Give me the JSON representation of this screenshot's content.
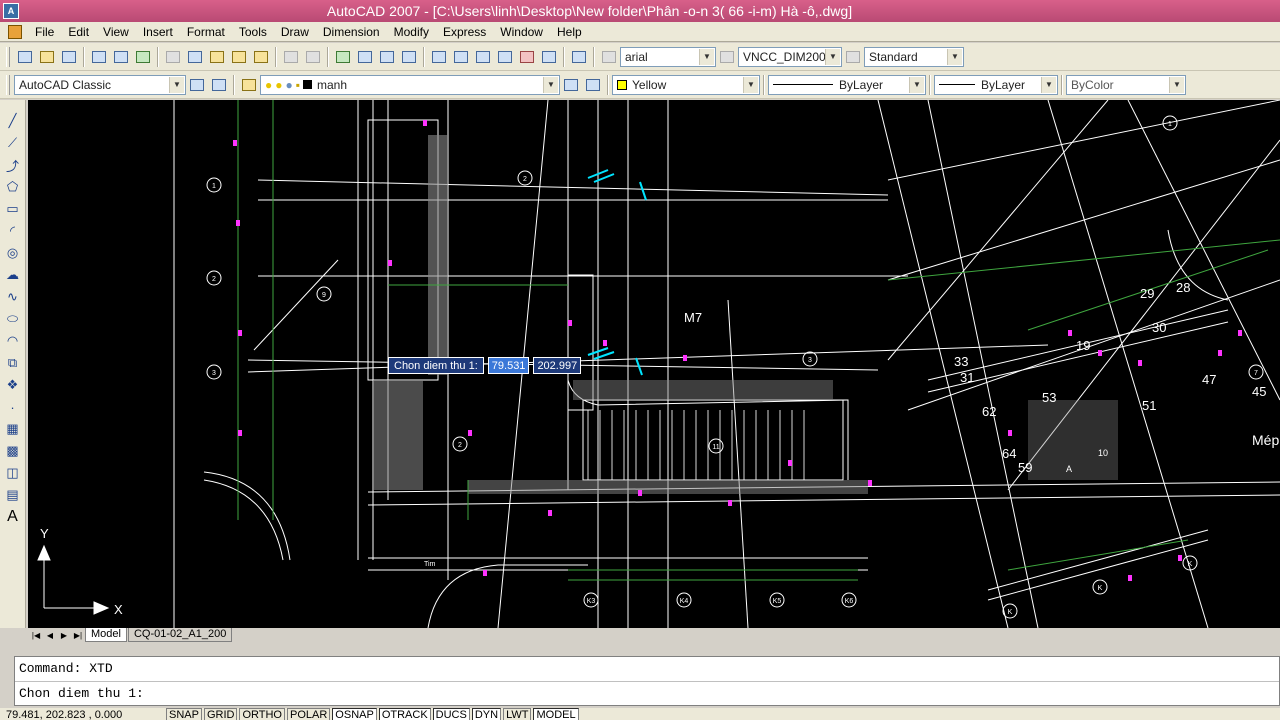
{
  "window": {
    "title": "AutoCAD 2007 - [C:\\Users\\linh\\Desktop\\New folder\\Phân -o-n 3( 66 -i-m)  Hà -ô,.dwg]"
  },
  "menu": [
    "File",
    "Edit",
    "View",
    "Insert",
    "Format",
    "Tools",
    "Draw",
    "Dimension",
    "Modify",
    "Express",
    "Window",
    "Help"
  ],
  "toolbar1": {
    "text_style": "arial",
    "dim_style": "VNCC_DIM200",
    "table_style": "Standard"
  },
  "toolbar2": {
    "workspace": "AutoCAD Classic",
    "layer": "manh",
    "color": "Yellow",
    "color_hex": "#ffff00",
    "linetype": "ByLayer",
    "lineweight": "ByLayer",
    "plotstyle": "ByColor"
  },
  "dynamic_input": {
    "prompt": "Chon diem thu 1:",
    "x_value": "79.531",
    "y_value": "202.997"
  },
  "drawing_labels": [
    "M7",
    "29",
    "28",
    "30",
    "19",
    "33",
    "31",
    "62",
    "53",
    "51",
    "47",
    "45",
    "59",
    "64",
    "10",
    "Mép",
    "A",
    "Tim"
  ],
  "ucs": {
    "x": "X",
    "y": "Y"
  },
  "layout_tabs": [
    "Model",
    "CQ-01-02_A1_200"
  ],
  "command_history": [
    "Command: XTD",
    "Chon diem thu 1:"
  ],
  "status": {
    "coords": "79.481, 202.823 , 0.000",
    "toggles": [
      "SNAP",
      "GRID",
      "ORTHO",
      "POLAR",
      "OSNAP",
      "OTRACK",
      "DUCS",
      "DYN",
      "LWT",
      "MODEL"
    ],
    "active": [
      "OSNAP",
      "OTRACK",
      "DUCS",
      "DYN",
      "MODEL"
    ]
  }
}
